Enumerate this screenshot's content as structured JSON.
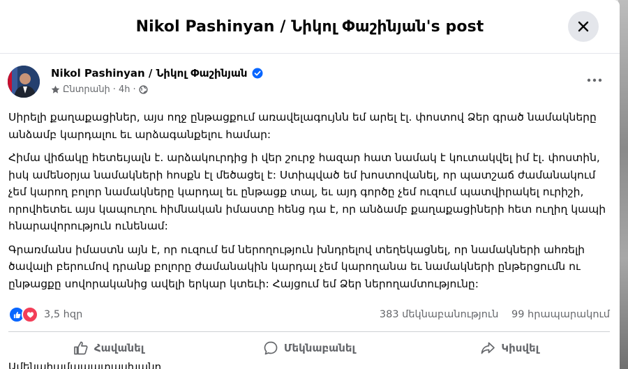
{
  "modal": {
    "title": "Nikol Pashinyan / Նիկոլ Փաշինյան's post"
  },
  "post": {
    "author": "Nikol Pashinyan / Նիկոլ Փաշինյան",
    "audience": "Ընտրանի",
    "time": "4h",
    "dot": "·",
    "paragraphs": [
      "Սիրելի քաղաքացիներ, այս ողջ ընթացքում առավելագույնն եմ արել էլ. փոստով Ձեր գրած նամակները անձամբ կարդալու եւ արձագանքելու համար:",
      "Հիմա վիճակը հետեւյալն է. արձակուրդից ի վեր շուրջ հազար հատ նամակ է կուտակվել իմ էլ. փոստին, իսկ ամենօրյա նամակների հոսքն էլ մեծացել է: Ստիպված եմ խոստովանել, որ պատշաճ ժամանակում չեմ կարող բոլոր նամակները կարդալ եւ ընթացք տալ, եւ այդ գործը չեմ ուզում պատվիրակել ուրիշի, որովհետեւ այս կապուղու հիմնական իմաստը հենց դա է, որ անձամբ քաղաքացիների հետ ուղիղ կապի հնարավորություն ունենամ:",
      "Գրառմանս իմաստն այն է, որ ուզում եմ ներողություն խնդրելով տեղեկացնել, որ նամակների ահռելի ծավալի բերումով դրանք բոլորը ժամանակին կարդալ չեմ կարողանա եւ նամակների ընթերցումն ու ընթացքը սովորականից ավելի երկար կտեւի: Հայցում եմ Ձեր ներողամտությունը:"
    ]
  },
  "stats": {
    "reactions": "3,5 հզր",
    "comments": "383 մեկնաբանություն",
    "shares": "99 հրապարակում"
  },
  "actions": {
    "like": "Հավանել",
    "comment": "Մեկնաբանել",
    "share": "Կիսվել"
  },
  "footer": {
    "cut_text": "Ամենահամապատասխանը"
  },
  "colors": {
    "accent": "#0866ff",
    "love": "#f33e58",
    "muted": "#65676b"
  }
}
